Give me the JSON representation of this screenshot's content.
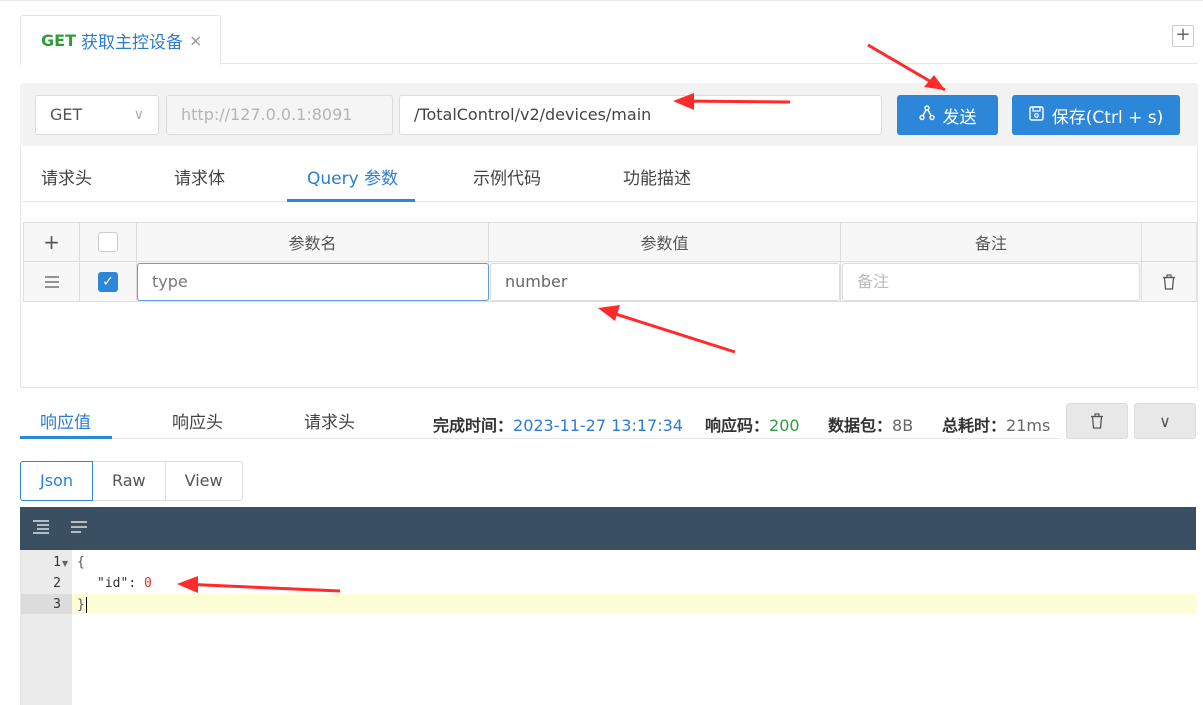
{
  "tabs": [
    {
      "method": "GET",
      "title": "获取主控设备",
      "close": "×"
    }
  ],
  "add_tab_label": "+",
  "request": {
    "method": "GET",
    "host_placeholder": "http://127.0.0.1:8091",
    "path": "/TotalControl/v2/devices/main",
    "send_label": "发送",
    "save_label": "保存(Ctrl + s)"
  },
  "request_tabs": [
    "请求头",
    "请求体",
    "Query 参数",
    "示例代码",
    "功能描述"
  ],
  "active_request_tab": "Query 参数",
  "params_table": {
    "add_label": "+",
    "headers": [
      "参数名",
      "参数值",
      "备注"
    ],
    "rows": [
      {
        "checked": true,
        "name": "type",
        "value": "number",
        "note_placeholder": "备注"
      }
    ]
  },
  "response_tabs": [
    "响应值",
    "响应头",
    "请求头"
  ],
  "active_response_tab": "响应值",
  "response_stats": {
    "finish_time_label": "完成时间：",
    "finish_time": "2023-11-27 13:17:34",
    "status_label": "响应码：",
    "status": "200",
    "size_label": "数据包：",
    "size": "8B",
    "elapsed_label": "总耗时：",
    "elapsed": "21ms"
  },
  "formats": [
    "Json",
    "Raw",
    "View"
  ],
  "active_format": "Json",
  "editor": {
    "line_numbers": [
      "1",
      "2",
      "3"
    ],
    "lines": {
      "open": "{",
      "key": "\"id\"",
      "colon": ": ",
      "value": "0",
      "close": "}"
    }
  },
  "colors": {
    "accent": "#2d87d8",
    "method_green": "#2e9d3c",
    "toolbar_dark": "#3b4f63",
    "arrow_red": "#ff2a2a"
  }
}
